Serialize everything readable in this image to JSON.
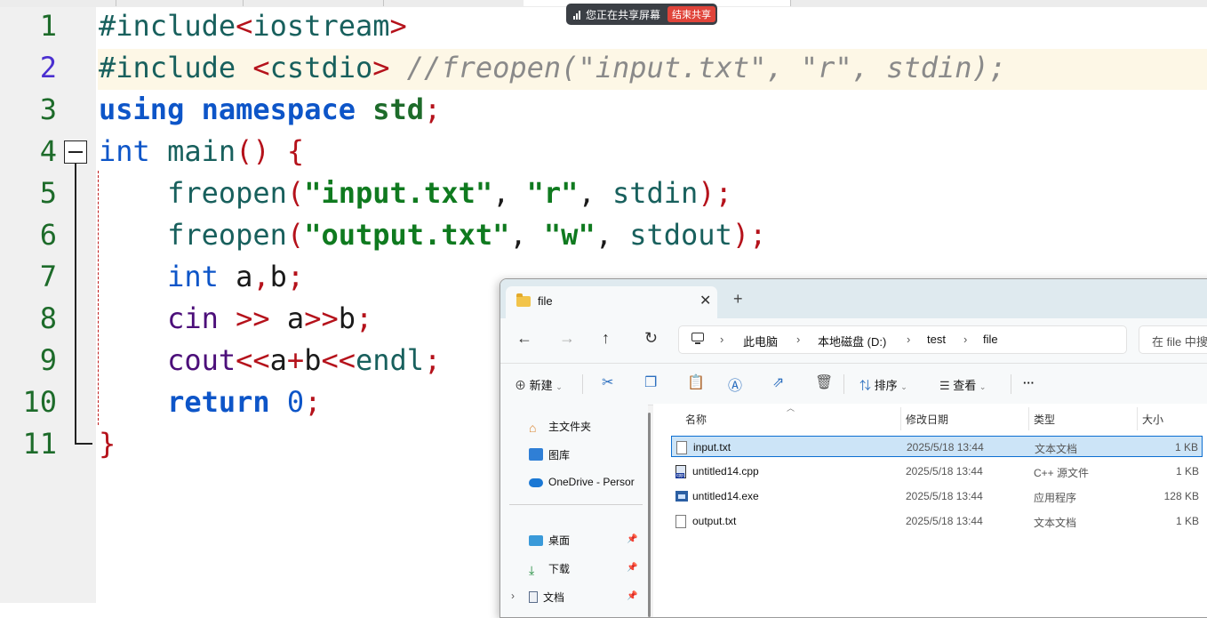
{
  "screen_share": {
    "status_text": "您正在共享屏幕",
    "stop_label": "结束共享"
  },
  "editor": {
    "line_numbers": [
      "1",
      "2",
      "3",
      "4",
      "5",
      "6",
      "7",
      "8",
      "9",
      "10",
      "11"
    ],
    "lines": [
      [
        [
          "#include",
          "pp"
        ],
        [
          "<",
          "op"
        ],
        [
          "iostream",
          "pp"
        ],
        [
          ">",
          "op"
        ]
      ],
      [
        [
          "#include ",
          "pp"
        ],
        [
          "<",
          "op"
        ],
        [
          "cstdio",
          "pp"
        ],
        [
          ">",
          "op"
        ],
        [
          " //freopen(\"input.txt\", \"r\", stdin);",
          "cm"
        ]
      ],
      [
        [
          "using",
          "kw"
        ],
        [
          " ",
          ""
        ],
        [
          "namespace",
          "kw"
        ],
        [
          " ",
          ""
        ],
        [
          "std",
          "green"
        ],
        [
          ";",
          "op"
        ]
      ],
      [
        [
          "int",
          "typ"
        ],
        [
          " ",
          ""
        ],
        [
          "main",
          "fn"
        ],
        [
          "()",
          "op"
        ],
        [
          " ",
          ""
        ],
        [
          "{",
          "op"
        ]
      ],
      [
        [
          "    ",
          ""
        ],
        [
          "freopen",
          "fn"
        ],
        [
          "(",
          "op"
        ],
        [
          "\"input.txt\"",
          "str"
        ],
        [
          ", ",
          ""
        ],
        [
          "\"r\"",
          "str"
        ],
        [
          ", ",
          ""
        ],
        [
          "stdin",
          "fn"
        ],
        [
          ")",
          "op"
        ],
        [
          ";",
          "op"
        ]
      ],
      [
        [
          "    ",
          ""
        ],
        [
          "freopen",
          "fn"
        ],
        [
          "(",
          "op"
        ],
        [
          "\"output.txt\"",
          "str"
        ],
        [
          ", ",
          ""
        ],
        [
          "\"w\"",
          "str"
        ],
        [
          ", ",
          ""
        ],
        [
          "stdout",
          "fn"
        ],
        [
          ")",
          "op"
        ],
        [
          ";",
          "op"
        ]
      ],
      [
        [
          "    ",
          ""
        ],
        [
          "int",
          "typ"
        ],
        [
          " a",
          ""
        ],
        [
          ",",
          "op"
        ],
        [
          "b",
          ""
        ],
        [
          ";",
          "op"
        ]
      ],
      [
        [
          "    ",
          ""
        ],
        [
          "cin",
          "io"
        ],
        [
          " ",
          ""
        ],
        [
          ">>",
          "op"
        ],
        [
          " a",
          ""
        ],
        [
          ">>",
          "op"
        ],
        [
          "b",
          ""
        ],
        [
          ";",
          "op"
        ]
      ],
      [
        [
          "    ",
          ""
        ],
        [
          "cout",
          "io"
        ],
        [
          "<<",
          "op"
        ],
        [
          "a",
          ""
        ],
        [
          "+",
          "op"
        ],
        [
          "b",
          ""
        ],
        [
          "<<",
          "op"
        ],
        [
          "endl",
          "fn"
        ],
        [
          ";",
          "op"
        ]
      ],
      [
        [
          "    ",
          ""
        ],
        [
          "return",
          "kw"
        ],
        [
          " ",
          ""
        ],
        [
          "0",
          "num"
        ],
        [
          ";",
          "op"
        ]
      ],
      [
        [
          "}",
          "op"
        ]
      ]
    ]
  },
  "explorer": {
    "tab_title": "file",
    "address": {
      "this_pc": "此电脑",
      "drive": "本地磁盘 (D:)",
      "folder1": "test",
      "folder2": "file"
    },
    "search_placeholder": "在 file 中搜",
    "toolbar": {
      "new_label": "新建",
      "sort_label": "排序",
      "view_label": "查看",
      "more_label": "···"
    },
    "nav": {
      "home": "主文件夹",
      "gallery": "图库",
      "onedrive": "OneDrive - Persor",
      "desktop": "桌面",
      "downloads": "下载",
      "documents": "文档"
    },
    "columns": {
      "name": "名称",
      "modified": "修改日期",
      "type": "类型",
      "size": "大小"
    },
    "files": [
      {
        "name": "input.txt",
        "modified": "2025/5/18 13:44",
        "type": "文本文档",
        "size": "1 KB",
        "icon": "txt-file-icon",
        "selected": true
      },
      {
        "name": "untitled14.cpp",
        "modified": "2025/5/18 13:44",
        "type": "C++ 源文件",
        "size": "1 KB",
        "icon": "cpp-file-icon",
        "selected": false
      },
      {
        "name": "untitled14.exe",
        "modified": "2025/5/18 13:44",
        "type": "应用程序",
        "size": "128 KB",
        "icon": "exe-file-icon",
        "selected": false
      },
      {
        "name": "output.txt",
        "modified": "2025/5/18 13:44",
        "type": "文本文档",
        "size": "1 KB",
        "icon": "txt-file-icon",
        "selected": false
      }
    ]
  },
  "colors": {
    "line_number": "#1d6b2a",
    "current_line_number": "#4a2fd0",
    "keyword": "#0d55c8",
    "string": "#0f7a1f",
    "operator": "#b5121b",
    "selection": "#cce4f7"
  }
}
